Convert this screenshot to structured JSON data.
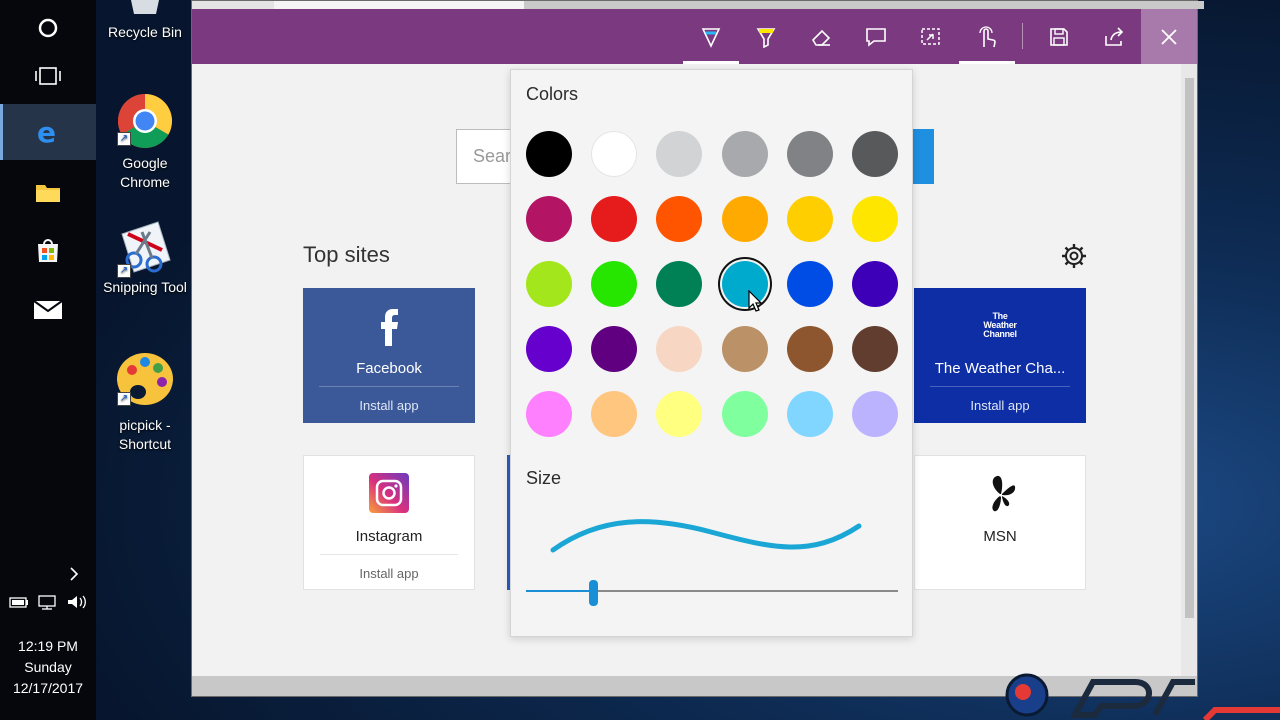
{
  "desktop": {
    "icons": [
      {
        "label": "Recycle Bin",
        "icon": "recycle-bin-icon"
      },
      {
        "label": "Google Chrome",
        "icon": "chrome-icon"
      },
      {
        "label": "Snipping Tool",
        "icon": "snipping-tool-icon"
      },
      {
        "label": "picpick - Shortcut",
        "icon": "picpick-icon"
      }
    ],
    "chrome_label_1": "Google",
    "chrome_label_2": "Chrome",
    "picpick_label_1": "picpick -",
    "picpick_label_2": "Shortcut"
  },
  "taskbar": {
    "buttons": [
      "cortana-icon",
      "task-view-icon",
      "edge-icon",
      "file-explorer-icon",
      "store-icon",
      "mail-icon"
    ],
    "active": "edge-icon",
    "tray": [
      "show-hidden-icons-icon",
      "battery-icon",
      "network-icon",
      "volume-icon"
    ],
    "clock": {
      "time": "12:19 PM",
      "day": "Sunday",
      "date": "12/17/2017"
    }
  },
  "ink_toolbar": {
    "tools": [
      "ballpoint-pen-icon",
      "highlighter-icon",
      "eraser-icon",
      "add-note-icon",
      "clip-icon",
      "touch-writing-icon",
      "save-icon",
      "share-icon",
      "close-icon"
    ],
    "selected_tools": [
      "ballpoint-pen-icon",
      "touch-writing-icon"
    ],
    "bar_color": "#7b3a80"
  },
  "page": {
    "search_placeholder": "Sear",
    "top_sites_label": "Top sites",
    "tiles": [
      {
        "name": "Facebook",
        "action": "Install app"
      },
      {
        "name": "The Weather Cha...",
        "action": "Install app",
        "logo": "The Weather Channel"
      },
      {
        "name": "Instagram",
        "action": "Install app"
      },
      {
        "name": "MSN",
        "action": ""
      }
    ],
    "weather_logo_1": "The",
    "weather_logo_2": "Weather",
    "weather_logo_3": "Channel"
  },
  "flyout": {
    "colors_label": "Colors",
    "size_label": "Size",
    "swatches": [
      "#000000",
      "#ffffff",
      "#d1d3d4",
      "#a7a9ac",
      "#808285",
      "#58595b",
      "#b31564",
      "#e61b1b",
      "#ff5500",
      "#ffaa00",
      "#ffce00",
      "#ffe600",
      "#a2e61b",
      "#26e600",
      "#008055",
      "#00aacc",
      "#004de6",
      "#3d00b8",
      "#6600cc",
      "#600080",
      "#f7d7c4",
      "#bb9167",
      "#8e562e",
      "#613d30",
      "#ff80ff",
      "#ffc680",
      "#ffff80",
      "#80ff9e",
      "#80d6ff",
      "#bcb3ff"
    ],
    "selected_swatch_index": 15,
    "size_value": 0.18,
    "preview_color": "#1aa7d6"
  }
}
